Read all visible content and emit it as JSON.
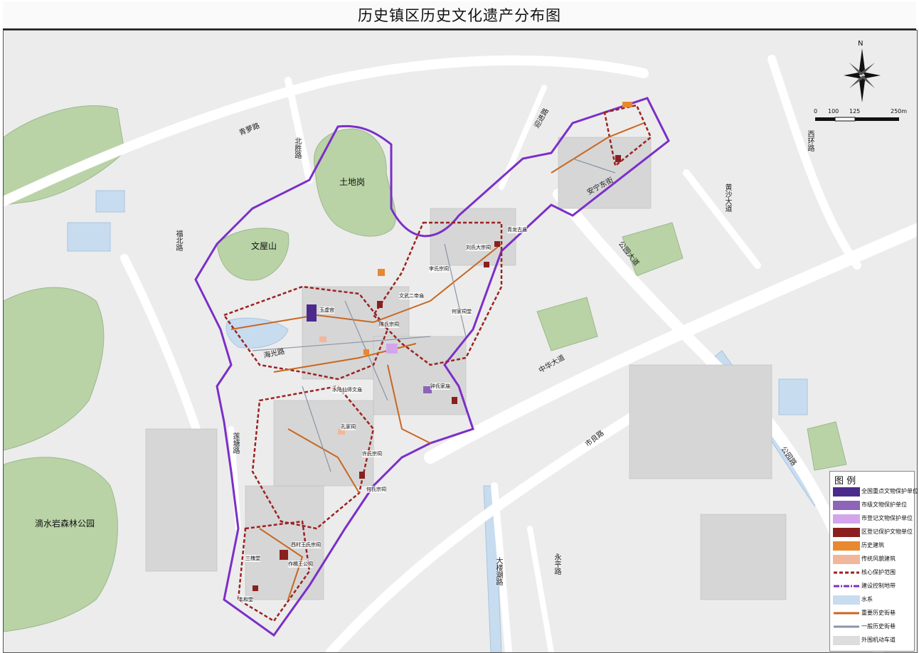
{
  "title": "历史镇区历史文化遗产分布图",
  "colors": {
    "national": "#4b2a8c",
    "municipal": "#8d64b8",
    "municipal_registered": "#d3a6ec",
    "district": "#8b1f1f",
    "historic_building": "#e8882f",
    "traditional_building": "#f2b79a",
    "core_boundary": "#9b2222",
    "control_boundary": "#7b2fc8",
    "water": "#c8dcf0",
    "major_street": "#c9671f",
    "minor_street": "#8a95a8",
    "road": "#dddddd",
    "green": "#b9d3a6"
  },
  "map": {
    "place_labels": [
      "土地岗",
      "文屋山",
      "滴水岩森林公园"
    ],
    "road_labels": [
      "青萝路",
      "北胜路",
      "福北路",
      "莲塘路",
      "迎进路",
      "黄沙大道",
      "西环路",
      "公园大道",
      "中华大道",
      "市良路",
      "海光路",
      "永平路",
      "大楼潮路",
      "公园路",
      "安宁东街"
    ],
    "site_labels": [
      "玉虚宫",
      "李氏宗祠",
      "陈氏宗祠",
      "水陆仙师文庙",
      "孔家祠",
      "许氏宗祠",
      "何氏宗祠",
      "钟氏家庙",
      "何家祠堂",
      "文武二帝庙",
      "刘氏大宗祠",
      "青龙古庙",
      "本和堂",
      "三槐堂",
      "西村王氏宗祠",
      "作楫王公祠"
    ]
  },
  "scale": {
    "ticks": [
      "0",
      "100",
      "125",
      "250m"
    ]
  },
  "compass": {
    "letter": "N"
  },
  "legend": {
    "title": "图 例",
    "items": [
      {
        "label": "全国重点文物保护单位",
        "color": "#4b2a8c"
      },
      {
        "label": "市级文物保护单位",
        "color": "#8d64b8"
      },
      {
        "label": "市登记文物保护单位",
        "color": "#d3a6ec"
      },
      {
        "label": "区登记保护文物单位",
        "color": "#8b1f1f"
      },
      {
        "label": "历史建筑",
        "color": "#e8882f"
      },
      {
        "label": "传统风貌建筑",
        "color": "#f2b79a"
      },
      {
        "label": "核心保护范围",
        "color": "#9b2222"
      },
      {
        "label": "建设控制地带",
        "color": "#7b2fc8"
      },
      {
        "label": "水系",
        "color": "#c8dcf0"
      },
      {
        "label": "重要历史街巷",
        "color": "#c9671f"
      },
      {
        "label": "一般历史街巷",
        "color": "#8a95a8"
      },
      {
        "label": "外围机动车道",
        "color": "#dddddd"
      }
    ]
  }
}
